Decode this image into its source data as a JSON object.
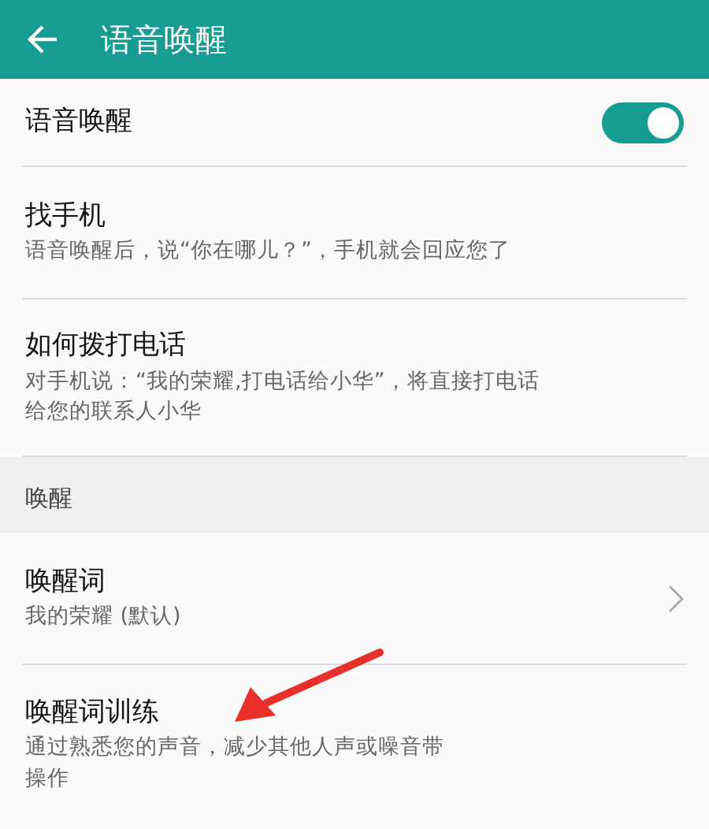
{
  "header": {
    "title": "语音唤醒"
  },
  "rows": [
    {
      "kind": "toggle",
      "title": "语音唤醒",
      "on": true
    },
    {
      "kind": "text",
      "title": "找手机",
      "lines": [
        "语音唤醒后，说“你在哪儿？”，手机就会回应您了"
      ]
    },
    {
      "kind": "text",
      "title": "如何拨打电话",
      "lines": [
        "对手机说：“我的荣耀,打电话给小华”，将直接打电话",
        "给您的联系人小华"
      ]
    },
    {
      "kind": "section",
      "title": "唤醒"
    },
    {
      "kind": "link",
      "title": "唤醒词",
      "lines": [
        "我的荣耀 (默认)"
      ]
    },
    {
      "kind": "text",
      "title": "唤醒词训练",
      "lines": [
        "通过熟悉您的声音，减少其他人声或噪音带",
        "操作"
      ]
    }
  ]
}
